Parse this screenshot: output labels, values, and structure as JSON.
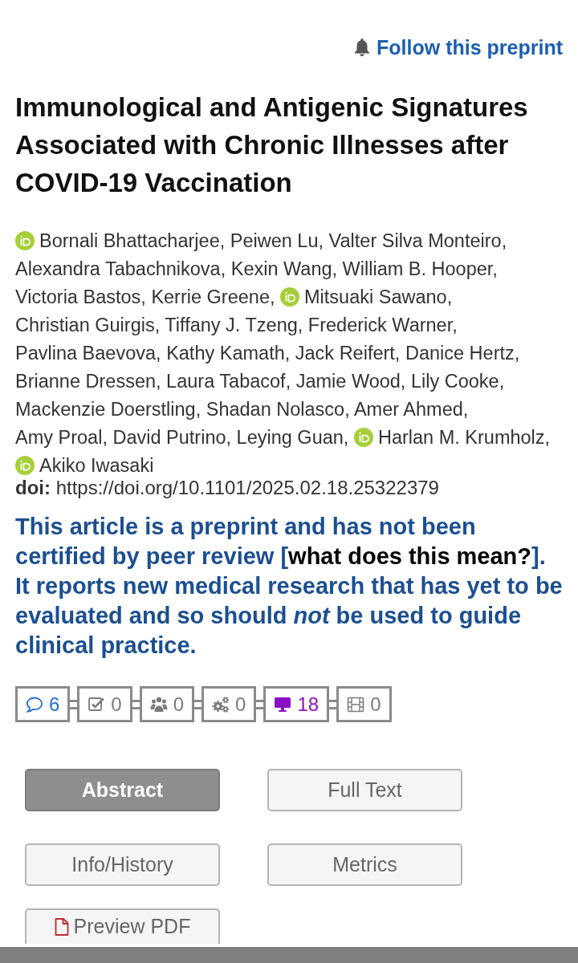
{
  "follow": {
    "label": "Follow this preprint"
  },
  "title": "Immunological and Antigenic Signatures Associated with Chronic Illnesses after COVID-19 Vaccination",
  "authors": [
    {
      "name": "Bornali Bhattacharjee,",
      "id_icon": true
    },
    {
      "name": "Peiwen Lu,",
      "id_icon": false
    },
    {
      "name": "Valter Silva Monteiro,",
      "id_icon": false
    },
    {
      "name": "Alexandra Tabachnikova,",
      "id_icon": false
    },
    {
      "name": "Kexin Wang,",
      "id_icon": false
    },
    {
      "name": "William B. Hooper,",
      "id_icon": false
    },
    {
      "name": "Victoria Bastos,",
      "id_icon": false
    },
    {
      "name": "Kerrie Greene,",
      "id_icon": false
    },
    {
      "name": "Mitsuaki Sawano,",
      "id_icon": true
    },
    {
      "name": "Christian Guirgis,",
      "id_icon": false
    },
    {
      "name": "Tiffany J. Tzeng,",
      "id_icon": false
    },
    {
      "name": "Frederick Warner,",
      "id_icon": false
    },
    {
      "name": "Pavlina Baevova,",
      "id_icon": false
    },
    {
      "name": "Kathy Kamath,",
      "id_icon": false
    },
    {
      "name": "Jack Reifert,",
      "id_icon": false
    },
    {
      "name": "Danice Hertz,",
      "id_icon": false
    },
    {
      "name": "Brianne Dressen,",
      "id_icon": false
    },
    {
      "name": "Laura Tabacof,",
      "id_icon": false
    },
    {
      "name": "Jamie Wood,",
      "id_icon": false
    },
    {
      "name": "Lily Cooke,",
      "id_icon": false
    },
    {
      "name": "Mackenzie Doerstling,",
      "id_icon": false
    },
    {
      "name": "Shadan Nolasco,",
      "id_icon": false
    },
    {
      "name": "Amer Ahmed,",
      "id_icon": false
    },
    {
      "name": "Amy Proal,",
      "id_icon": false
    },
    {
      "name": "David Putrino,",
      "id_icon": false
    },
    {
      "name": "Leying Guan,",
      "id_icon": false
    },
    {
      "name": "Harlan M. Krumholz,",
      "id_icon": true
    },
    {
      "name": "Akiko Iwasaki",
      "id_icon": true
    }
  ],
  "doi": {
    "label": "doi:",
    "url": "https://doi.org/10.1101/2025.02.18.25322379"
  },
  "notice": {
    "before": "This article is a preprint and has not been certified by peer review [",
    "link": "what does this mean?",
    "after": "]. It reports new medical research that has yet to be evaluated and so should *not* be used to guide clinical practice."
  },
  "metrics": [
    {
      "count": "6",
      "color": "#1f6fd1"
    },
    {
      "count": "0",
      "color": "#7b7b7b"
    },
    {
      "count": "0",
      "color": "#7b7b7b"
    },
    {
      "count": "0",
      "color": "#7b7b7b"
    },
    {
      "count": "18",
      "color": "#8a12c6"
    },
    {
      "count": "0",
      "color": "#7b7b7b"
    }
  ],
  "tabs": [
    {
      "label": "Abstract",
      "selected": true
    },
    {
      "label": "Full Text",
      "selected": false
    },
    {
      "label": "Info/History",
      "selected": false
    },
    {
      "label": "Metrics",
      "selected": false
    }
  ],
  "pdf_button": {
    "label": "Preview PDF"
  }
}
